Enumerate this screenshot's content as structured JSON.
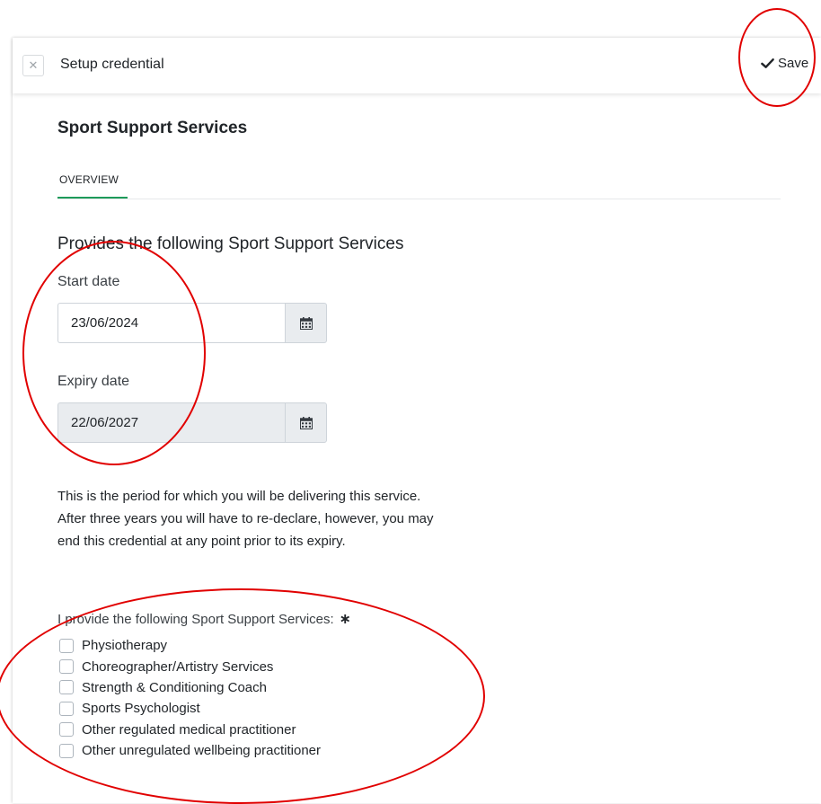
{
  "topbar": {
    "close_icon": "close-icon",
    "title": "Setup credential",
    "save_label": "Save",
    "save_icon": "checkmark-icon"
  },
  "page": {
    "heading": "Sport Support Services",
    "tabs": [
      {
        "label": "OVERVIEW",
        "active": true
      }
    ],
    "accent_color": "#1e9b5a"
  },
  "form": {
    "section_heading": "Provides the following Sport Support Services",
    "start_date": {
      "label": "Start date",
      "value": "23/06/2024",
      "icon": "calendar-icon"
    },
    "expiry_date": {
      "label": "Expiry date",
      "value": "22/06/2027",
      "readonly": true,
      "icon": "calendar-icon"
    },
    "help_lines": [
      "This is the period for which you will be delivering this service.",
      "After three years you will have to re-declare, however, you may",
      "end this credential at any point prior to its expiry."
    ],
    "services_label": "I provide the following Sport Support Services:",
    "required_marker": "∗",
    "services": [
      {
        "label": "Physiotherapy",
        "checked": false
      },
      {
        "label": "Choreographer/Artistry Services",
        "checked": false
      },
      {
        "label": "Strength & Conditioning Coach",
        "checked": false
      },
      {
        "label": "Sports Psychologist",
        "checked": false
      },
      {
        "label": "Other regulated medical practitioner",
        "checked": false
      },
      {
        "label": "Other unregulated wellbeing practitioner",
        "checked": false
      }
    ]
  },
  "annotations": {
    "color": "#e10000"
  }
}
